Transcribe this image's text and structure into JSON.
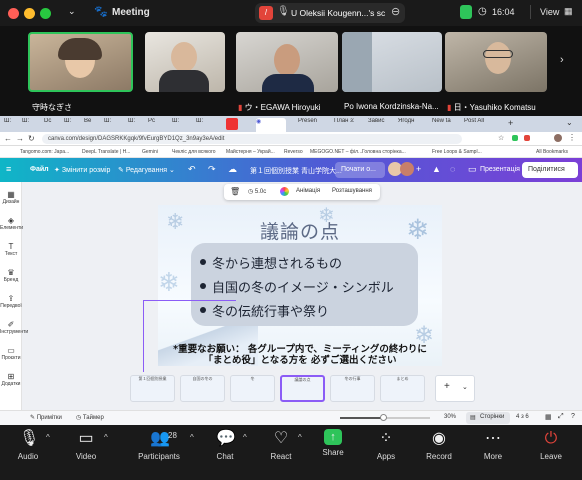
{
  "zoom": {
    "title": "Meeting",
    "share_notice": "U Oleksii Kougenn...'s sc",
    "time": "16:04",
    "view_label": "View",
    "participants": [
      {
        "name": "守時なぎさ"
      },
      {
        "name": ""
      },
      {
        "name": "ウ・EGAWA Hiroyuki"
      },
      {
        "name": "Po Iwona Kordzinska-Na..."
      },
      {
        "name": "日・Yasuhiko Komatsu"
      }
    ],
    "controls": {
      "audio": "Audio",
      "video": "Video",
      "participants": "Participants",
      "participants_count": "28",
      "chat": "Chat",
      "react": "React",
      "share": "Share",
      "apps": "Apps",
      "record": "Record",
      "more": "More",
      "leave": "Leave"
    }
  },
  "browser": {
    "tabs": [
      "Ш:",
      "Ш:",
      "Dc",
      "Ш:",
      "Be",
      "Ш:",
      "Ш:",
      "Pc",
      "Ш:",
      "Ш:",
      "",
      "Presen",
      "План з:",
      "Завис",
      "Ягодн",
      "New ta",
      "Post All"
    ],
    "url": "canva.com/design/DAGSRKKgqk/9fvEurgBYD1Qz_3n9ay3eA/edit",
    "bookmarks": [
      "Tangomo.com: Japa...",
      "DeepL Translate | H...",
      "Gemini",
      "Чекліс для всякого",
      "Майстерня – Украй...",
      "Reverso",
      "MEGOGO.NET – філ...",
      "Головна сторінка...",
      "Free Loops & Sampl...",
      "All Bookmarks"
    ]
  },
  "canva": {
    "file": "Файл",
    "resize": "Змінити розмір",
    "editing": "Редагування",
    "doc_title": "第１回個別授業 青山学院大...",
    "share_button": "Почати о...",
    "present": "Презентація",
    "share": "Поділитися",
    "left_nav": [
      "Дизайн",
      "Елементи",
      "Текст",
      "Бренд",
      "Передвої",
      "Інструменти",
      "Проєкти",
      "Додатки"
    ],
    "toolbar": {
      "duration": "5.0с",
      "animation": "Анімація",
      "position": "Розташування"
    },
    "slide": {
      "title": "議論の点",
      "bullets": [
        "冬から連想されるもの",
        "自国の冬のイメージ・シンボル",
        "冬の伝統行事や祭り"
      ],
      "note_line1": "*重要なお願い： 各グループ内で、ミーティングの終わりに",
      "note_line2": "「まとめ役」となる方を 必ずご選出ください"
    },
    "thumbnails": [
      "第１回個別授業",
      "自国の冬の",
      "冬",
      "議論の点",
      "冬の行事",
      "まとめ",
      "発表"
    ],
    "status": {
      "notes": "Примітки",
      "timer": "Таймер",
      "zoom": "30%",
      "pages": "Сторінки",
      "page_count": "4 з 6"
    }
  },
  "colors": {
    "zoom_bg": "#1a1a1a",
    "canva_grad_start": "#0fb6c7",
    "canva_grad_end": "#7b3fd6",
    "share_green": "#2ec45a",
    "leave_red": "#e0433a"
  }
}
